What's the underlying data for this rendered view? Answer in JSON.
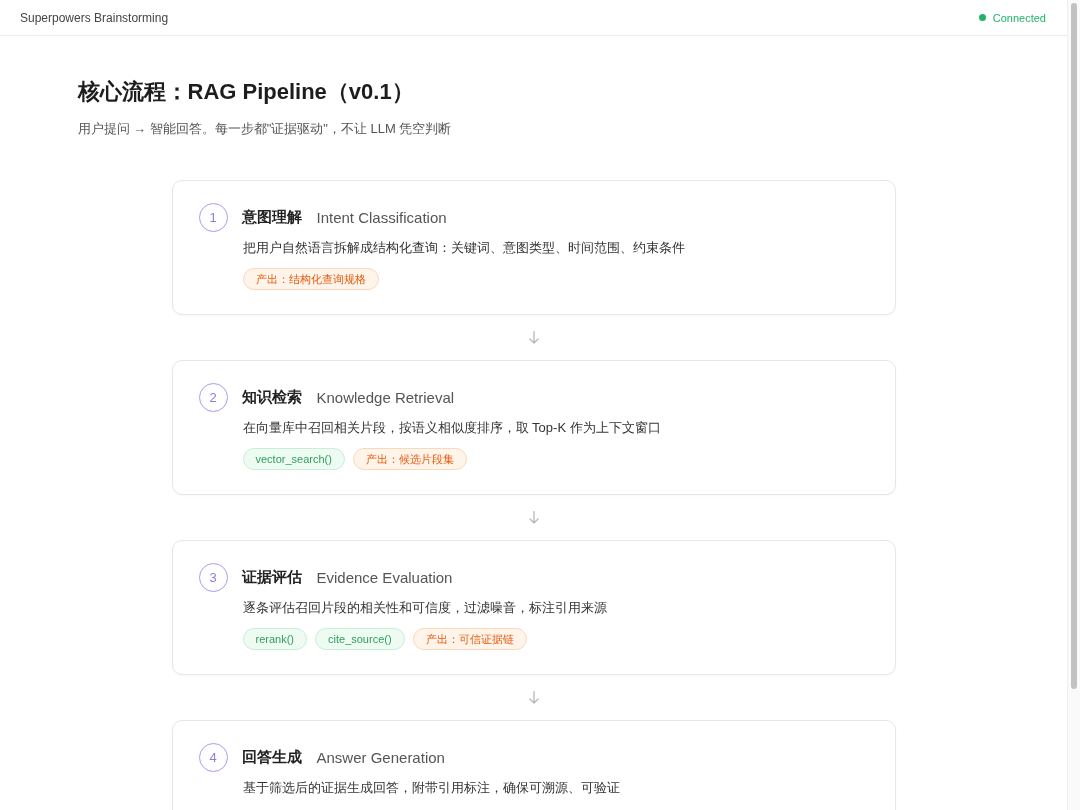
{
  "header": {
    "title": "Superpowers Brainstorming",
    "status": {
      "text": "Connected",
      "online": true
    }
  },
  "page": {
    "title": "核心流程：RAG Pipeline（v0.1）",
    "subtitle": "用户提问 → 智能回答。每一步都\"证据驱动\"，不让 LLM 凭空判断"
  },
  "steps": [
    {
      "number": "1",
      "title": "意图理解",
      "subtitle": "Intent Classification",
      "description": "把用户自然语言拆解成结构化查询：关键词、意图类型、时间范围、约束条件",
      "tags": [
        {
          "kind": "output",
          "text": "产出：结构化查询规格"
        }
      ]
    },
    {
      "number": "2",
      "title": "知识检索",
      "subtitle": "Knowledge Retrieval",
      "description": "在向量库中召回相关片段，按语义相似度排序，取 Top-K 作为上下文窗口",
      "tags": [
        {
          "kind": "function",
          "text": "vector_search()"
        },
        {
          "kind": "output",
          "text": "产出：候选片段集"
        }
      ]
    },
    {
      "number": "3",
      "title": "证据评估",
      "subtitle": "Evidence Evaluation",
      "description": "逐条评估召回片段的相关性和可信度，过滤噪音，标注引用来源",
      "tags": [
        {
          "kind": "function",
          "text": "rerank()"
        },
        {
          "kind": "function",
          "text": "cite_source()"
        },
        {
          "kind": "output",
          "text": "产出：可信证据链"
        }
      ]
    },
    {
      "number": "4",
      "title": "回答生成",
      "subtitle": "Answer Generation",
      "description": "基于筛选后的证据生成回答，附带引用标注，确保可溯源、可验证"
    }
  ]
}
